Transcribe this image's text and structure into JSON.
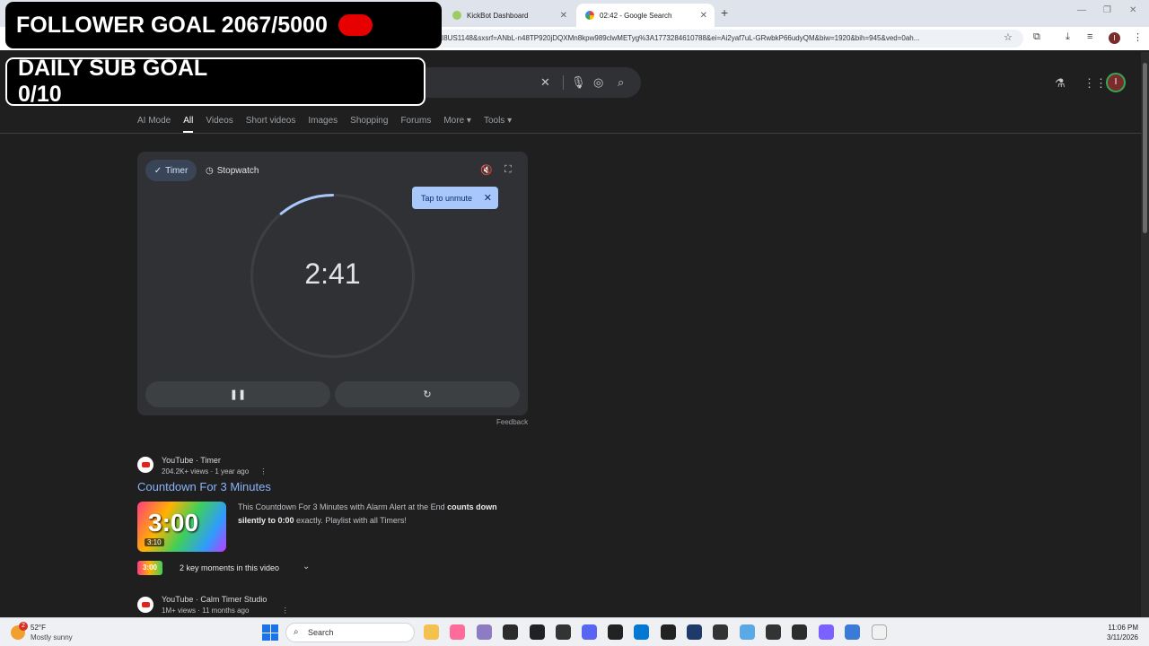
{
  "browser": {
    "tabs": [
      {
        "title": "KickBot Dashboard",
        "active": false
      },
      {
        "title": "02:42 - Google Search",
        "active": true
      }
    ],
    "url": "I8US1148&sxsrf=ANbL-n48TP920jDQXMn8kpw989clwMETyg%3A1773284610788&ei=Ai2yaf7uL-GRwbkP66udyQM&biw=1920&bih=945&ved=0ah...",
    "profile_initial": "I"
  },
  "overlays": {
    "follower_goal": "FOLLOWER GOAL 2067/5000",
    "daily_sub_goal": "DAILY SUB GOAL 0/10"
  },
  "google": {
    "nav_tabs": [
      "AI Mode",
      "All",
      "Videos",
      "Short videos",
      "Images",
      "Shopping",
      "Forums",
      "More",
      "Tools"
    ],
    "active_tab": "All",
    "avatar_initial": "I"
  },
  "timer": {
    "mode_tabs": {
      "timer": "Timer",
      "stopwatch": "Stopwatch"
    },
    "tooltip": "Tap to unmute",
    "time_display": "2:41",
    "progress_remaining_fraction": 0.89,
    "feedback": "Feedback"
  },
  "results": [
    {
      "source": "YouTube · Timer",
      "meta": "204.2K+ views · 1 year ago",
      "title": "Countdown For 3 Minutes",
      "thumb_text": "3:00",
      "duration": "3:10",
      "snippet_plain": "This Countdown For 3 Minutes with Alarm Alert at the End ",
      "snippet_bold1": "counts down silently to 0:00",
      "snippet_tail": " exactly. Playlist with all Timers!",
      "key_moments_thumb": "3:00",
      "key_moments": "2 key moments in this video"
    },
    {
      "source": "YouTube · Calm Timer Studio",
      "meta": "1M+ views · 11 months ago"
    }
  ],
  "taskbar": {
    "weather_badge": "2",
    "weather_temp": "52°F",
    "weather_desc": "Mostly sunny",
    "search_label": "Search",
    "time": "11:06 PM",
    "date": "3/11/2026"
  },
  "colors": {
    "accent_blue": "#8ab4f8",
    "tooltip_bg": "#a8c7fa",
    "overlay_red": "#e60000",
    "page_bg": "#1f1f1f"
  }
}
